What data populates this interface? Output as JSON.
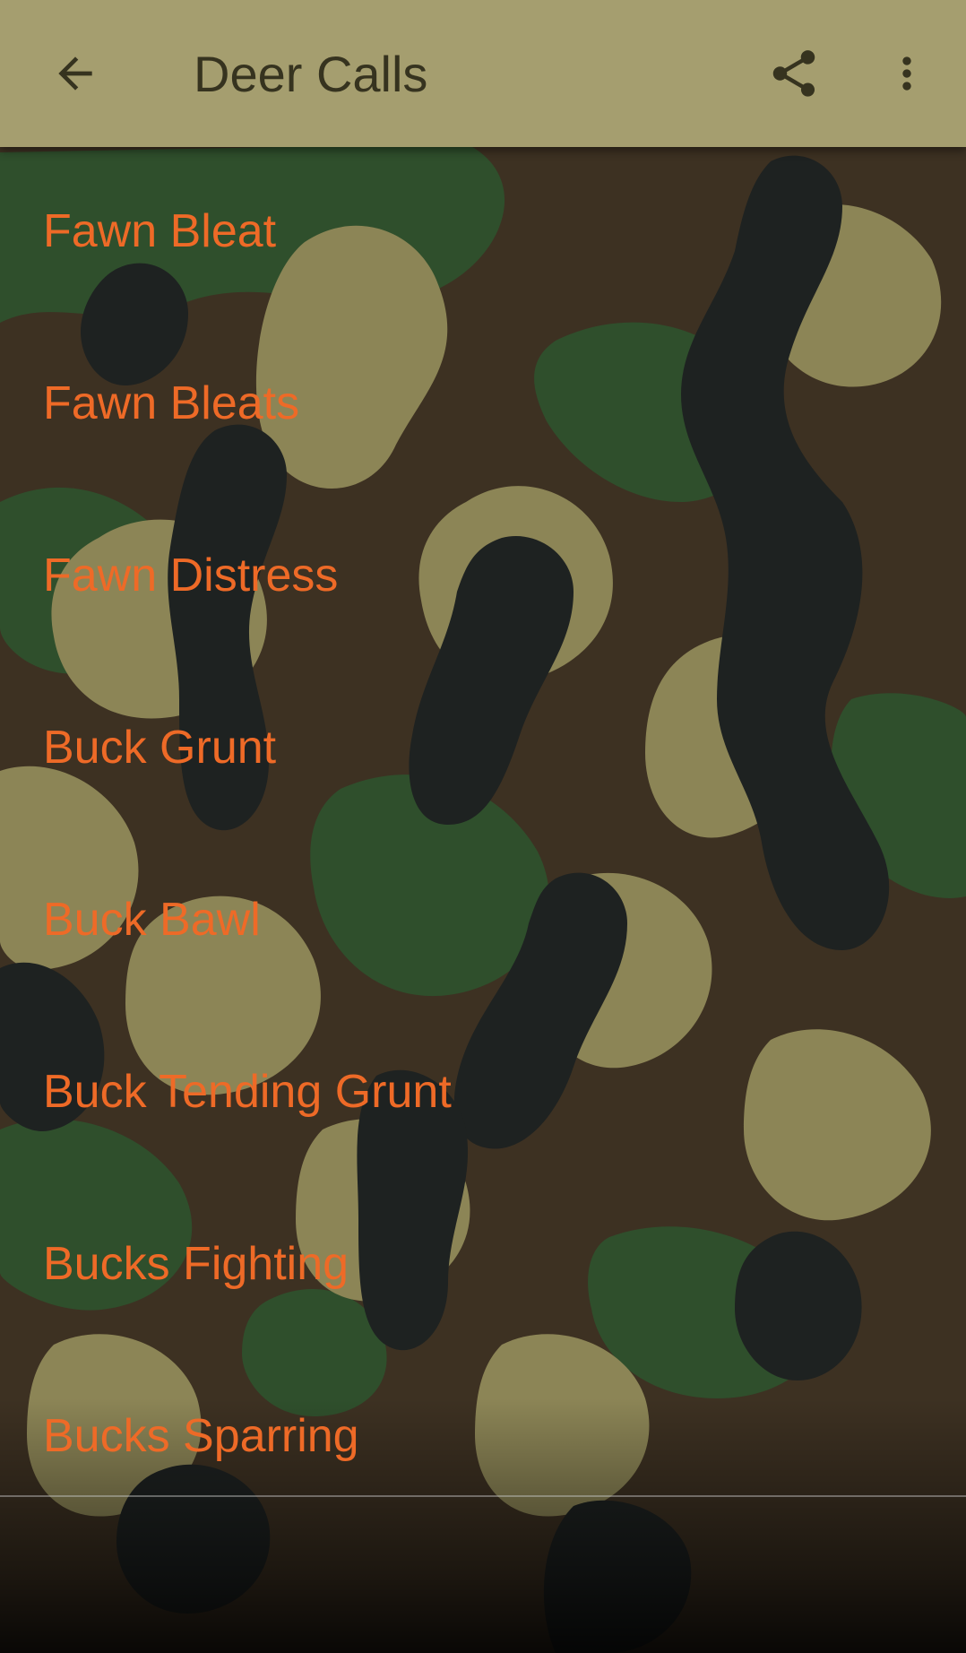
{
  "app_bar": {
    "title": "Deer Calls",
    "back_icon": "arrow-back-icon",
    "share_icon": "share-icon",
    "more_icon": "more-vert-icon",
    "background_color": "#a59e6f",
    "text_color": "#36331f"
  },
  "calls": [
    {
      "label": "Fawn Bleat"
    },
    {
      "label": "Fawn Bleats"
    },
    {
      "label": "Fawn Distress"
    },
    {
      "label": "Buck Grunt"
    },
    {
      "label": "Buck Bawl"
    },
    {
      "label": "Buck Tending Grunt"
    },
    {
      "label": "Bucks Fighting"
    },
    {
      "label": "Bucks Sparring"
    }
  ],
  "colors": {
    "item_text": "#ee6a27",
    "camo_brown": "#3d3122",
    "camo_green": "#2f4f2c",
    "camo_tan": "#8c8556",
    "camo_black": "#1e2221"
  }
}
